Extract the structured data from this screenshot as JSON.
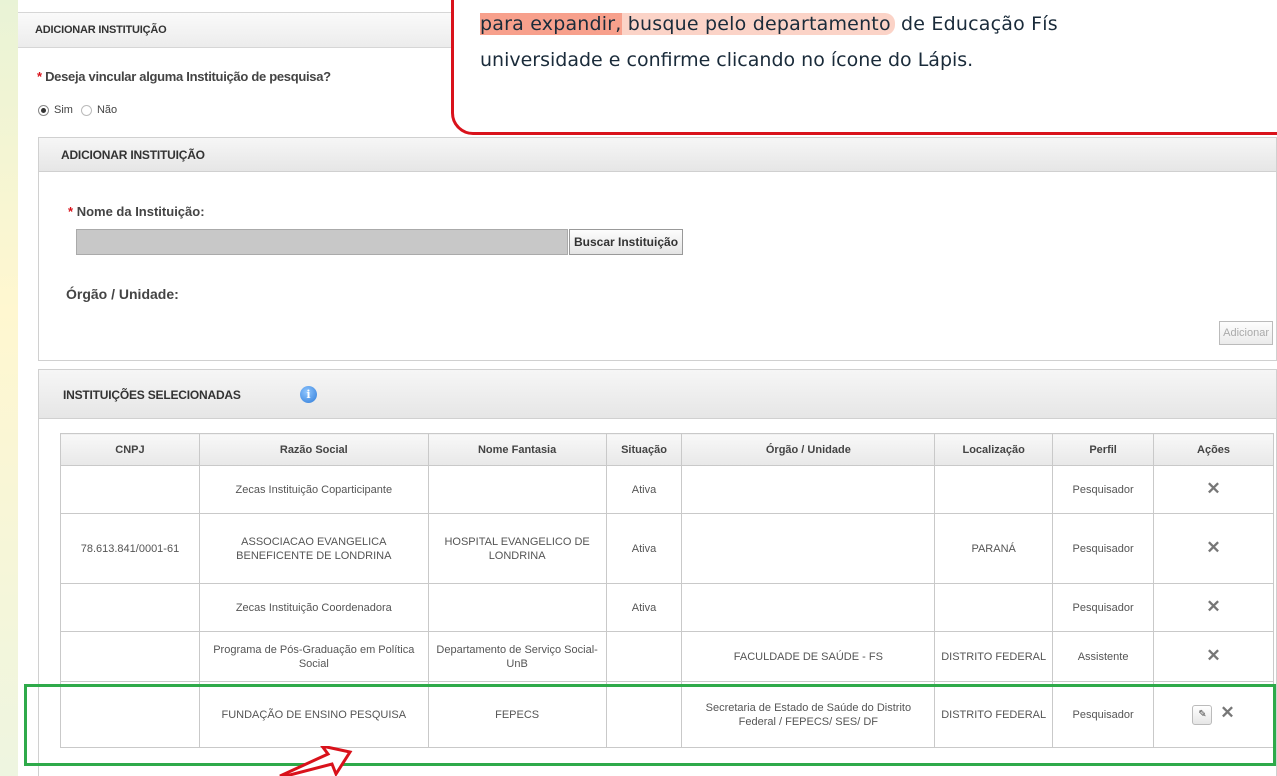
{
  "outer_section": {
    "title": "ADICIONAR INSTITUIÇÃO",
    "question": "Deseja vincular alguma Instituição de pesquisa?",
    "required_mark": "*",
    "radio_yes": "Sim",
    "radio_no": "Não",
    "selected": "Sim"
  },
  "add_panel": {
    "title": "ADICIONAR INSTITUIÇÃO",
    "nome_label": "Nome da Instituição:",
    "nome_value": "",
    "buscar_button": "Buscar Instituição",
    "orgao_label": "Órgão / Unidade:",
    "adicionar_button": "Adicionar"
  },
  "selected_panel": {
    "title": "INSTITUIÇÕES SELECIONADAS",
    "info_icon": "i",
    "columns": [
      "CNPJ",
      "Razão Social",
      "Nome Fantasia",
      "Situação",
      "Órgão / Unidade",
      "Localização",
      "Perfil",
      "Ações"
    ],
    "rows": [
      {
        "cnpj": "",
        "razao": "Zecas Instituição Coparticipante",
        "fantasia": "",
        "situacao": "Ativa",
        "orgao": "",
        "local": "",
        "perfil": "Pesquisador",
        "acoes": [
          "delete-icon"
        ]
      },
      {
        "cnpj": "78.613.841/0001-61",
        "razao": "ASSOCIACAO EVANGELICA BENEFICENTE DE LONDRINA",
        "fantasia": "HOSPITAL EVANGELICO DE LONDRINA",
        "situacao": "Ativa",
        "orgao": "",
        "local": "PARANÁ",
        "perfil": "Pesquisador",
        "acoes": [
          "delete-icon"
        ]
      },
      {
        "cnpj": "",
        "razao": "Zecas Instituição Coordenadora",
        "fantasia": "",
        "situacao": "Ativa",
        "orgao": "",
        "local": "",
        "perfil": "Pesquisador",
        "acoes": [
          "delete-icon"
        ]
      },
      {
        "cnpj": "",
        "razao": "Programa de Pós-Graduação em Política Social",
        "fantasia": "Departamento de Serviço Social- UnB",
        "situacao": "",
        "orgao": "FACULDADE DE SAÚDE - FS",
        "local": "DISTRITO FEDERAL",
        "perfil": "Assistente",
        "acoes": [
          "delete-icon"
        ]
      },
      {
        "cnpj": "",
        "razao": "FUNDAÇÃO DE ENSINO PESQUISA",
        "fantasia": "FEPECS",
        "situacao": "",
        "orgao": "Secretaria de Estado de Saúde do Distrito Federal / FEPECS/ SES/ DF",
        "local": "DISTRITO FEDERAL",
        "perfil": "Pesquisador",
        "acoes": [
          "edit-pencil-icon",
          "delete-icon"
        ]
      }
    ]
  },
  "callout": {
    "line1_hl": "para expandir,",
    "line1_mid": " busque pelo departamento",
    "line1_end": " de Educação Fís",
    "line2": "universidade e confirme clicando no ícone do Lápis."
  },
  "colors": {
    "callout_border": "#d9121b",
    "highlight": "#f7a08c",
    "green_box": "#2eaa4a"
  }
}
